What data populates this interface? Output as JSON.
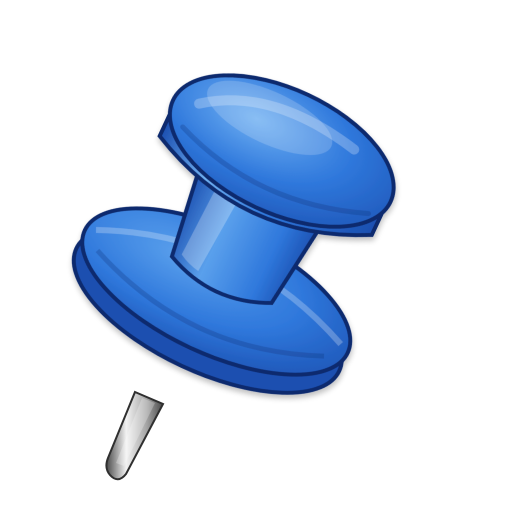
{
  "icon": {
    "name": "pushpin-icon",
    "colors": {
      "body_light": "#5aa0ec",
      "body_mid": "#2f78dc",
      "body_dark": "#1b4fb0",
      "outline": "#0e2a6e",
      "highlight": "#ffffff",
      "needle_light": "#f2f2f2",
      "needle_mid": "#a7a7a7",
      "needle_dark": "#4a4a4a"
    }
  }
}
